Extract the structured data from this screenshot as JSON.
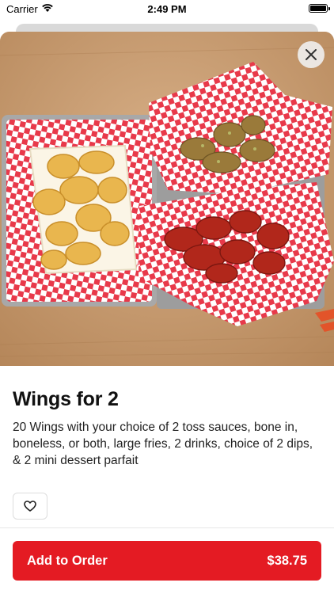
{
  "status_bar": {
    "carrier": "Carrier",
    "time": "2:49 PM"
  },
  "item": {
    "title": "Wings for 2",
    "description": "20 Wings with your choice of 2 toss sauces, bone in, boneless, or both, large fries, 2 drinks, choice of 2 dips, & 2 mini dessert parfait",
    "image_icon": "food-photo"
  },
  "actions": {
    "add_label": "Add to Order",
    "price": "$38.75"
  },
  "colors": {
    "accent": "#e41b23"
  },
  "icons": {
    "close": "close-icon",
    "favorite": "heart-icon"
  }
}
